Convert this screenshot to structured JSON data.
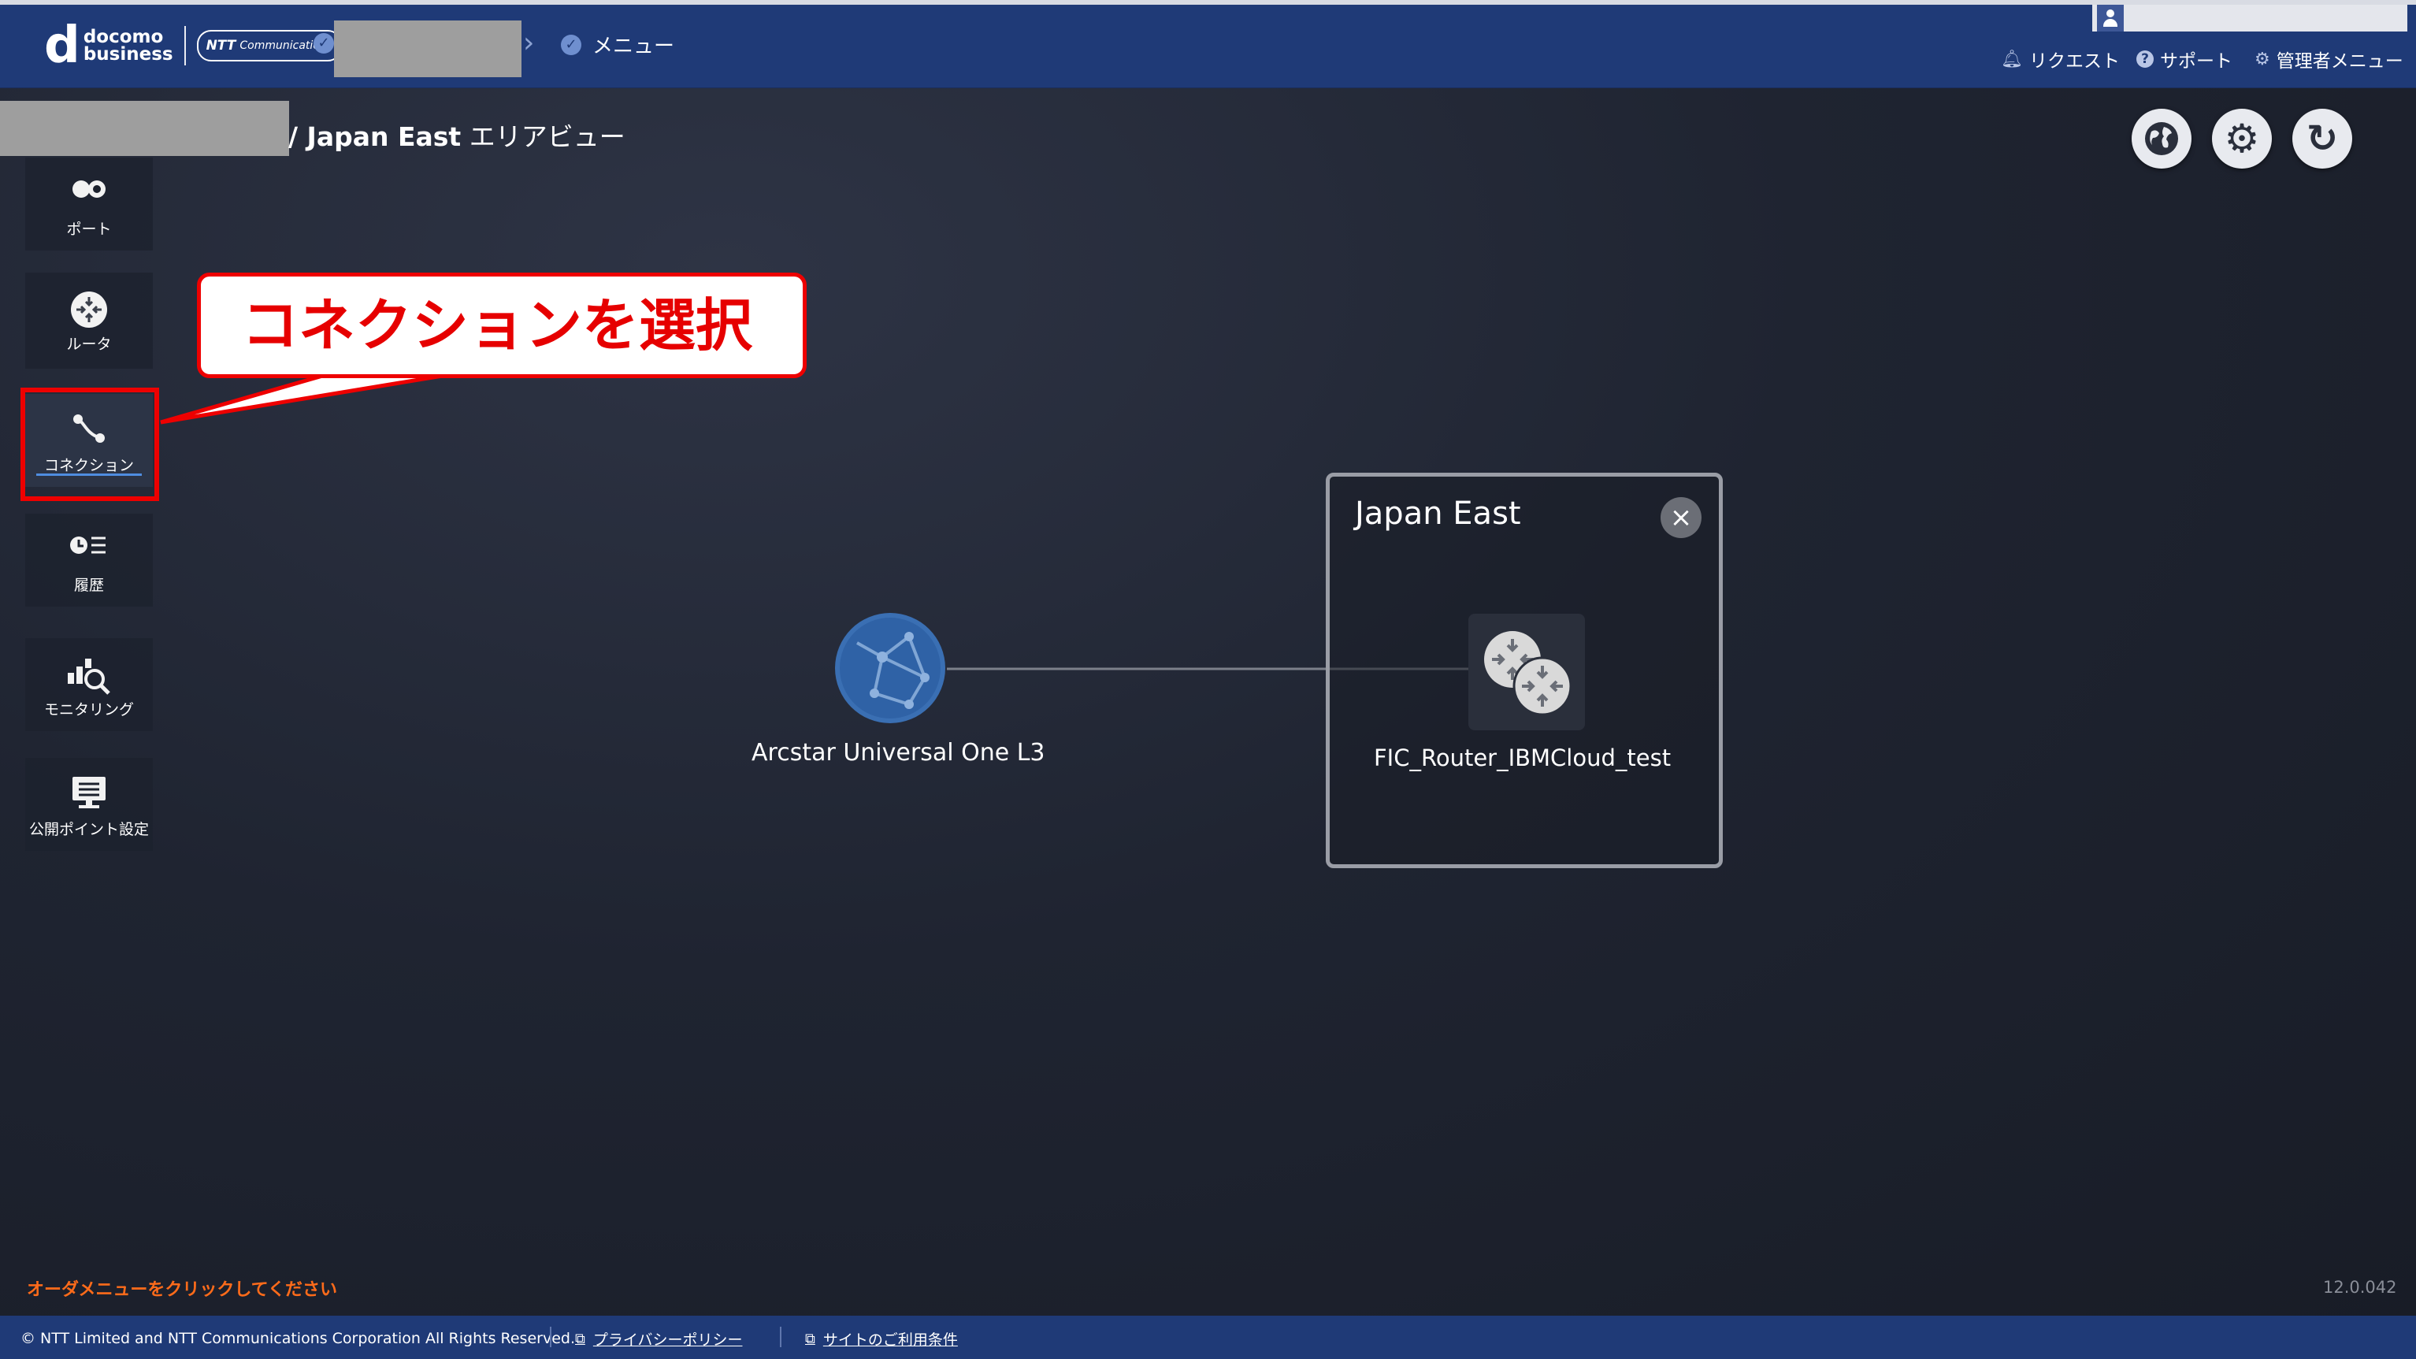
{
  "header": {
    "brand_d": "d",
    "brand_line1": "docomo",
    "brand_line2": "business",
    "ntt_logo_main": "NTT",
    "ntt_logo_sub": "Communications",
    "breadcrumb_menu": "メニュー",
    "nav": [
      {
        "label": "リクエスト",
        "icon": "bell-icon"
      },
      {
        "label": "サポート",
        "icon": "help-icon"
      },
      {
        "label": "管理者メニュー",
        "icon": "gear-icon"
      }
    ]
  },
  "title": {
    "area": "/ Japan East",
    "view": " エリアビュー"
  },
  "sidebar": {
    "items": [
      {
        "label": "ポート",
        "icon": "port-icon"
      },
      {
        "label": "ルータ",
        "icon": "router-icon"
      },
      {
        "label": "コネクション",
        "icon": "connection-icon",
        "active": true
      },
      {
        "label": "履歴",
        "icon": "history-icon"
      },
      {
        "label": "モニタリング",
        "icon": "monitoring-icon"
      },
      {
        "label": "公開ポイント設定",
        "icon": "public-point-icon"
      }
    ]
  },
  "callout": {
    "text": "コネクションを選択"
  },
  "diagram": {
    "external_node_label": "Arcstar Universal One L3",
    "area_name": "Japan East",
    "router_label": "FIC_Router_IBMCloud_test"
  },
  "footer": {
    "note": "オーダメニューをクリックしてください",
    "version": "12.0.042",
    "copyright": "© NTT Limited and NTT Communications Corporation All Rights Reserved.",
    "privacy": "プライバシーポリシー",
    "terms": "サイトのご利用条件"
  },
  "colors": {
    "header_bg": "#1f3a77",
    "highlight_red": "#e00000",
    "note_orange": "#ff6b1a"
  }
}
